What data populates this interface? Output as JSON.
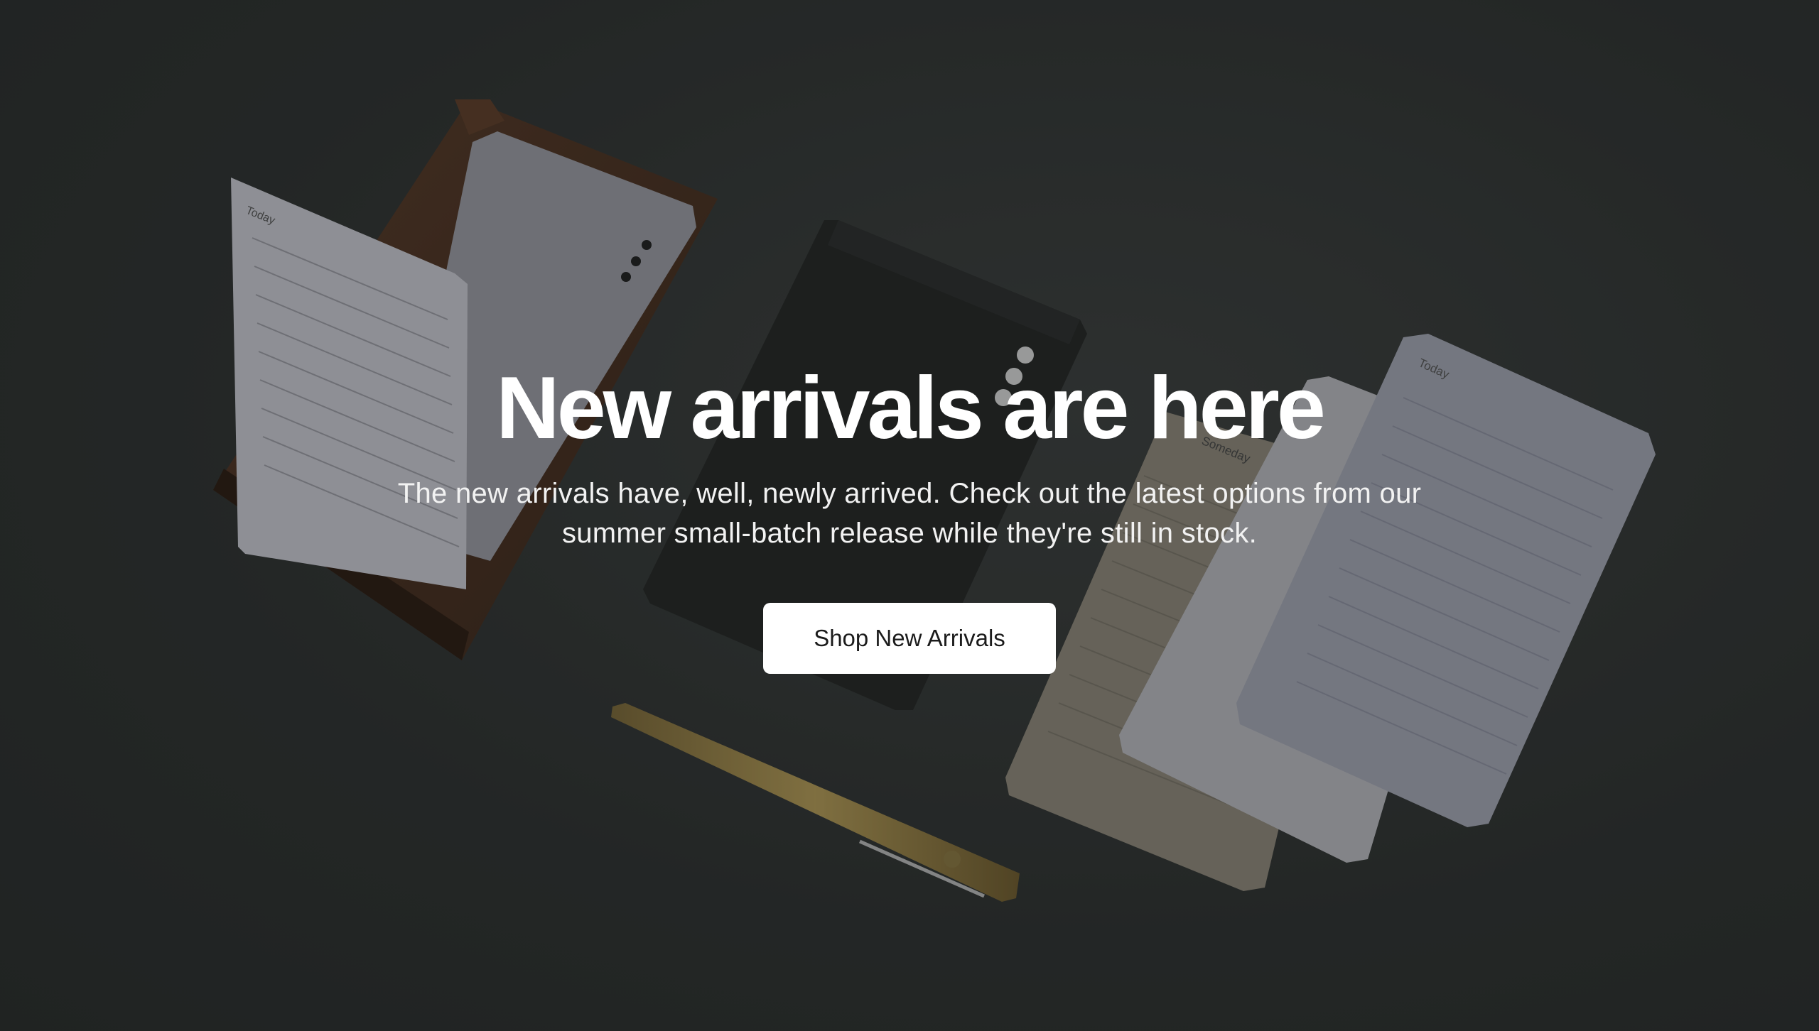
{
  "hero": {
    "headline": "New arrivals are here",
    "subtext": "The new arrivals have, well, newly arrived. Check out the latest options from our summer small-batch release while they're still in stock.",
    "cta_label": "Shop New Arrivals",
    "background_image": "desk-stationery-photo",
    "card_label_today": "Today",
    "card_label_someday": "Someday"
  },
  "colors": {
    "background": "#2f3231",
    "text": "#ffffff",
    "button_bg": "#ffffff",
    "button_text": "#1b1b1b"
  }
}
